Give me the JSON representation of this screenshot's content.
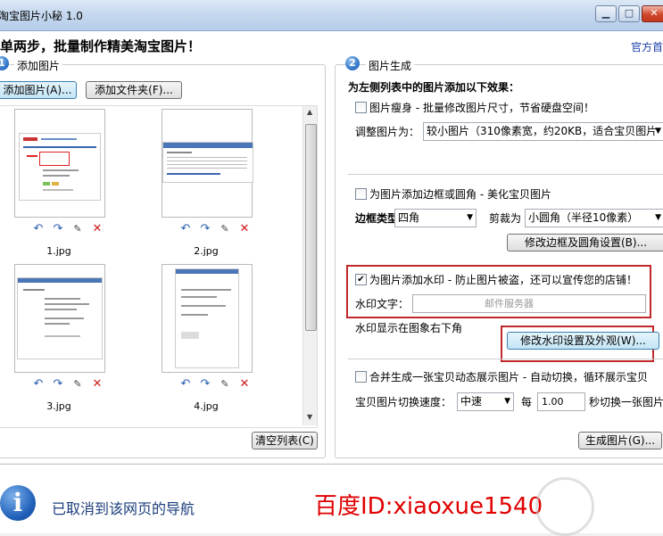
{
  "window": {
    "title": "淘宝图片小秘 1.0"
  },
  "header": {
    "text": "单两步，批量制作精美淘宝图片！",
    "official_link": "官方首"
  },
  "left": {
    "step": "1",
    "title": "添加图片",
    "add_images_button": "添加图片(A)...",
    "add_folder_button": "添加文件夹(F)...",
    "thumbnails": [
      {
        "name": "1.jpg"
      },
      {
        "name": "2.jpg"
      },
      {
        "name": "3.jpg"
      },
      {
        "name": "4.jpg"
      }
    ],
    "clear_list_button": "清空列表(C)"
  },
  "right": {
    "step": "2",
    "title": "图片生成",
    "intro": "为左侧列表中的图片添加以下效果：",
    "slim": {
      "label": "图片瘦身 - 批量修改图片尺寸，节省硬盘空间！",
      "checked": false,
      "adjust_label": "调整图片为：",
      "adjust_value": "较小图片（310像素宽，约20KB，适合宝贝图片"
    },
    "border": {
      "label": "为图片添加边框或圆角 - 美化宝贝图片",
      "checked": false,
      "style_label": "边框类型",
      "style_value": "四角",
      "crop_label": "剪裁为",
      "crop_value": "小圆角（半径10像素）",
      "settings_button": "修改边框及圆角设置(B)..."
    },
    "watermark": {
      "label": "为图片添加水印 - 防止图片被盗，还可以宣传您的店铺！",
      "checked": true,
      "text_label": "水印文字：",
      "text_value": "邮件服务器",
      "position_text": "水印显示在图象右下角",
      "settings_button": "修改水印设置及外观(W)..."
    },
    "animate": {
      "label": "合并生成一张宝贝动态展示图片 - 自动切换，循环展示宝贝",
      "checked": false,
      "speed_label": "宝贝图片切换速度：",
      "speed_value": "中速",
      "every_label": "每",
      "seconds_value": "1.00",
      "seconds_suffix": "秒切换一张图片"
    },
    "generate_button": "生成图片(G)..."
  },
  "infobar": {
    "message": "已取消到该网页的导航",
    "watermark_text": "百度ID:xiaoxue1540"
  },
  "colors": {
    "accent_red": "#c0282a",
    "link_blue": "#1a3da8",
    "info_red": "#e00000"
  }
}
